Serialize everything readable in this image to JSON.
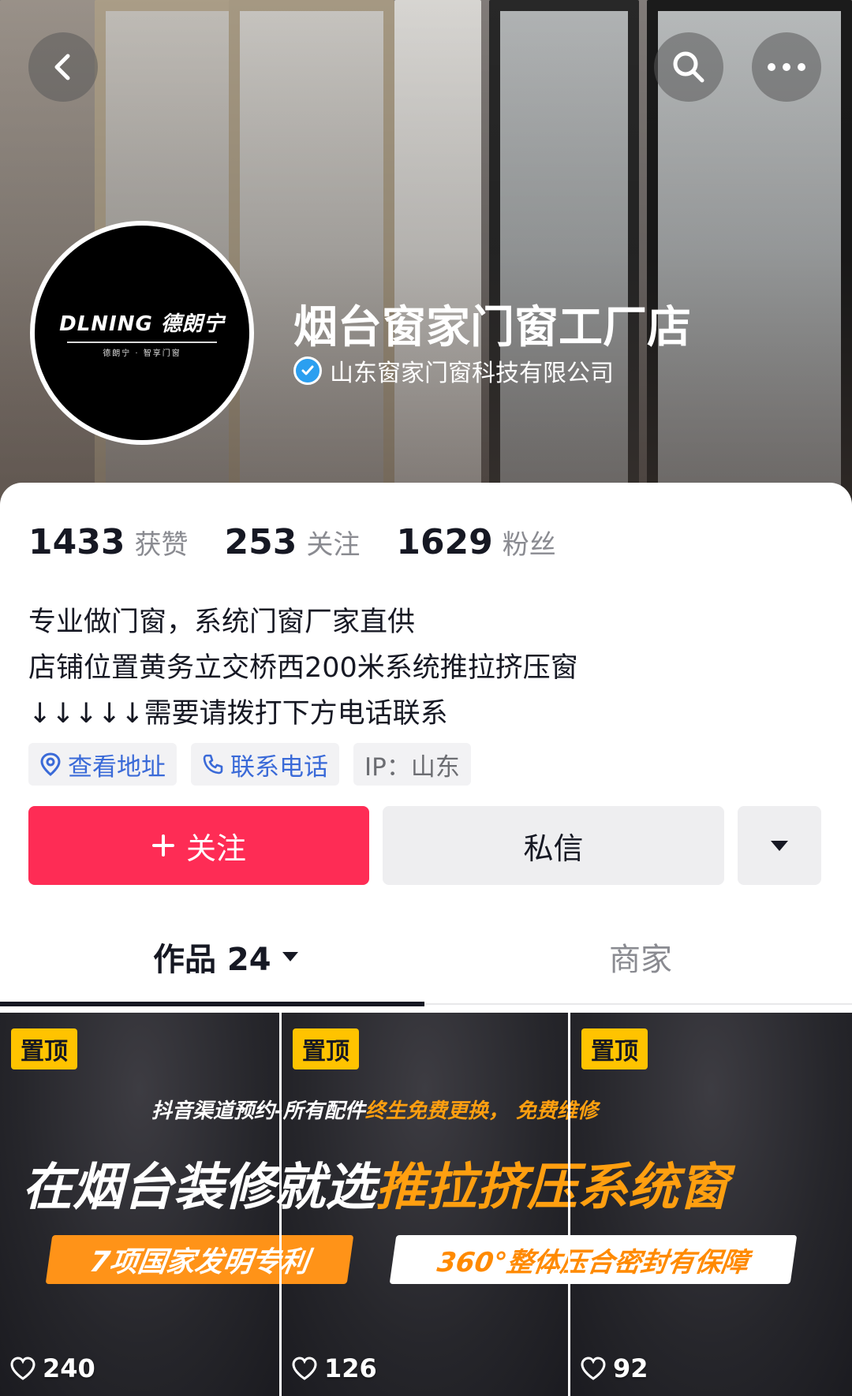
{
  "profile": {
    "name": "烟台窗家门窗工厂店",
    "company": "山东窗家门窗科技有限公司",
    "avatar_brand": "DLNING 德朗宁",
    "avatar_brand_sub": "德朗宁 · 智享门窗"
  },
  "stats": [
    {
      "num": "1433",
      "label": "获赞"
    },
    {
      "num": "253",
      "label": "关注"
    },
    {
      "num": "1629",
      "label": "粉丝"
    }
  ],
  "bio": {
    "line1": "专业做门窗，系统门窗厂家直供",
    "line2": "店铺位置黄务立交桥西200米系统推拉挤压窗",
    "line3": "↓↓↓↓↓需要请拨打下方电话联系"
  },
  "chips": {
    "address": "查看地址",
    "phone": "联系电话",
    "ip": "IP：山东"
  },
  "actions": {
    "follow": "关注",
    "message": "私信"
  },
  "tabs": {
    "works": "作品 24",
    "shop": "商家"
  },
  "videos": [
    {
      "pin": "置顶",
      "likes": "240"
    },
    {
      "pin": "置顶",
      "likes": "126"
    },
    {
      "pin": "置顶",
      "likes": "92"
    }
  ],
  "banner": {
    "line1_a": "抖音渠道预约-所有配件",
    "line1_b": "终生免费更换，",
    "line1_c": "免费维修",
    "line2_a": "在烟台装修就选",
    "line2_b": "推拉挤压系统窗",
    "tag1": "7项国家发明专利",
    "tag2": "360°整体压合密封有保障"
  },
  "colors": {
    "follow_button": "#fe2c55",
    "link_blue": "#3a6ad8",
    "pin_yellow": "#ffc300",
    "accent_orange": "#ff9f10",
    "verified_blue": "#2b9ff0"
  }
}
